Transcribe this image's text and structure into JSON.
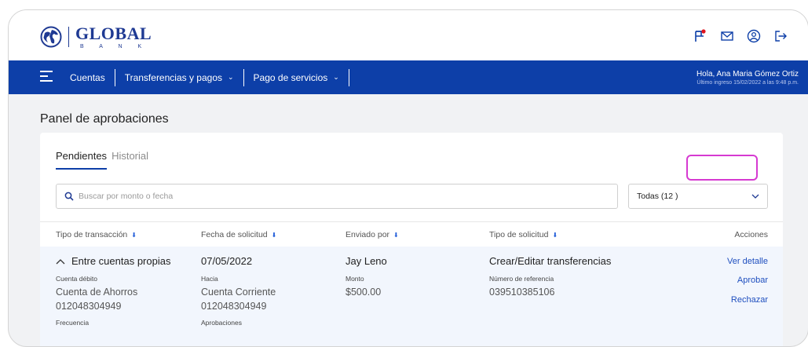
{
  "brand": {
    "name": "GLOBAL",
    "sub": "B A N K"
  },
  "nav": {
    "items": [
      {
        "label": "Cuentas",
        "caret": ""
      },
      {
        "label": "Transferencias y pagos",
        "caret": "⌄"
      },
      {
        "label": "Pago de servicios",
        "caret": "⌄"
      }
    ]
  },
  "user": {
    "greeting": "Hola, Ana Maria Gómez Ortiz",
    "last_login": "Último ingreso 15/02/2022 a las 9:48 p.m."
  },
  "page": {
    "title": "Panel de aprobaciones"
  },
  "tabs": {
    "active": "Pendientes",
    "inactive": "Historial"
  },
  "search": {
    "placeholder": "Buscar por monto o fecha"
  },
  "filter": {
    "value": "Todas (12 )"
  },
  "table": {
    "headers": {
      "type": "Tipo de transacción",
      "date": "Fecha de solicitud",
      "sender": "Enviado por",
      "request_type": "Tipo de solicitud",
      "actions": "Acciones"
    },
    "row": {
      "type": "Entre cuentas propias",
      "date": "07/05/2022",
      "sender": "Jay Leno",
      "request_type": "Crear/Editar transferencias",
      "debit_label": "Cuenta débito",
      "debit_type": "Cuenta de Ahorros",
      "debit_number": "012048304949",
      "to_label": "Hacia",
      "to_type": "Cuenta Corriente",
      "to_number": "012048304949",
      "amount_label": "Monto",
      "amount": "$500.00",
      "ref_label": "Número de referencia",
      "ref": "039510385106",
      "freq_label": "Frecuencia",
      "approvals_label": "Aprobaciones",
      "action_detail": "Ver detalle",
      "action_approve": "Aprobar",
      "action_reject": "Rechazar"
    }
  },
  "colors": {
    "primary": "#0d3fa8",
    "highlight": "#d63ad1",
    "link": "#1f4fbf",
    "notification": "#e0141e"
  }
}
